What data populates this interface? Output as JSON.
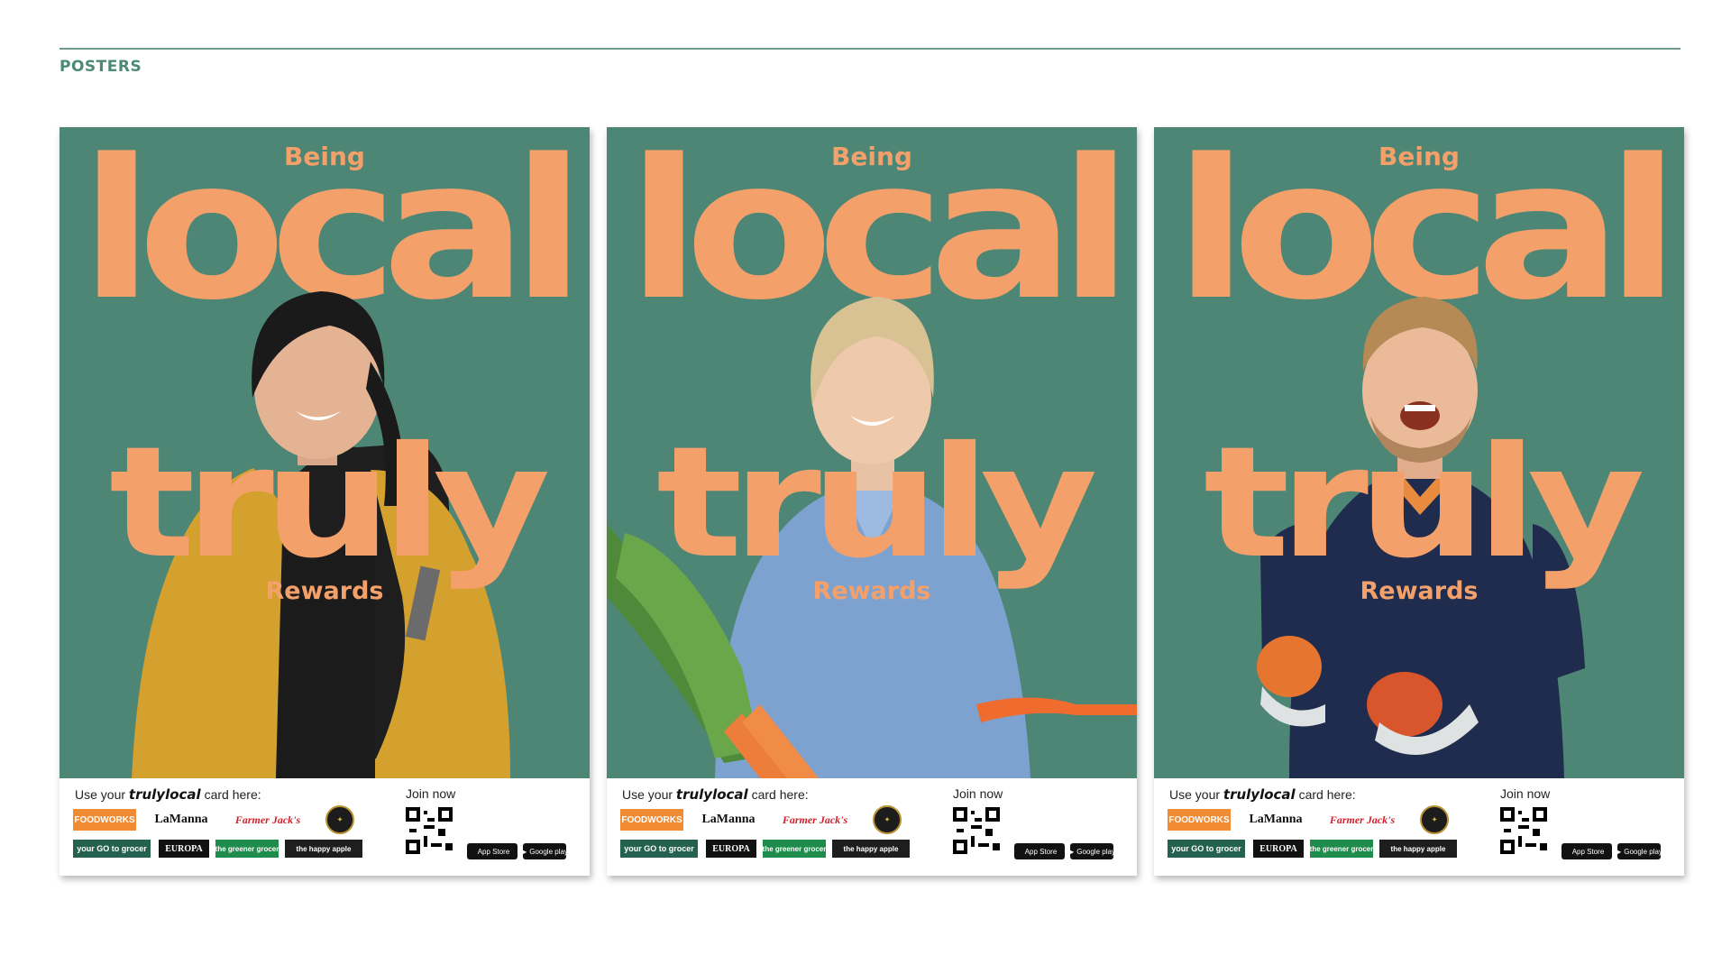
{
  "section_title": "POSTERS",
  "colors": {
    "poster_bg": "#4e8676",
    "accent": "#f4a06a",
    "title": "#4c8a77"
  },
  "posters": [
    {
      "being": "Being",
      "local": "local",
      "truly": "truly",
      "rewards": "Rewards",
      "person": "woman-in-yellow-cardigan",
      "footer": {
        "use_prefix": "Use your",
        "brand": "trulylocal",
        "use_suffix": "card here:",
        "join": "Join now",
        "logos": [
          "FOODWORKS",
          "LaManna",
          "Farmer Jack's",
          "Seal",
          "your GO to grocer",
          "EUROPA",
          "the greener grocer",
          "the happy apple"
        ],
        "app_store": "App Store",
        "google_play": "Google play"
      }
    },
    {
      "being": "Being",
      "local": "local",
      "truly": "truly",
      "rewards": "Rewards",
      "person": "woman-with-carrots",
      "footer": {
        "use_prefix": "Use your",
        "brand": "trulylocal",
        "use_suffix": "card here:",
        "join": "Join now",
        "logos": [
          "FOODWORKS",
          "LaManna",
          "Farmer Jack's",
          "Seal",
          "your GO to grocer",
          "EUROPA",
          "the greener grocer",
          "the happy apple"
        ],
        "app_store": "App Store",
        "google_play": "Google play"
      }
    },
    {
      "being": "Being",
      "local": "local",
      "truly": "truly",
      "rewards": "Rewards",
      "person": "man-with-mangoes",
      "footer": {
        "use_prefix": "Use your",
        "brand": "trulylocal",
        "use_suffix": "card here:",
        "join": "Join now",
        "logos": [
          "FOODWORKS",
          "LaManna",
          "Farmer Jack's",
          "Seal",
          "your GO to grocer",
          "EUROPA",
          "the greener grocer",
          "the happy apple"
        ],
        "app_store": "App Store",
        "google_play": "Google play"
      }
    }
  ]
}
